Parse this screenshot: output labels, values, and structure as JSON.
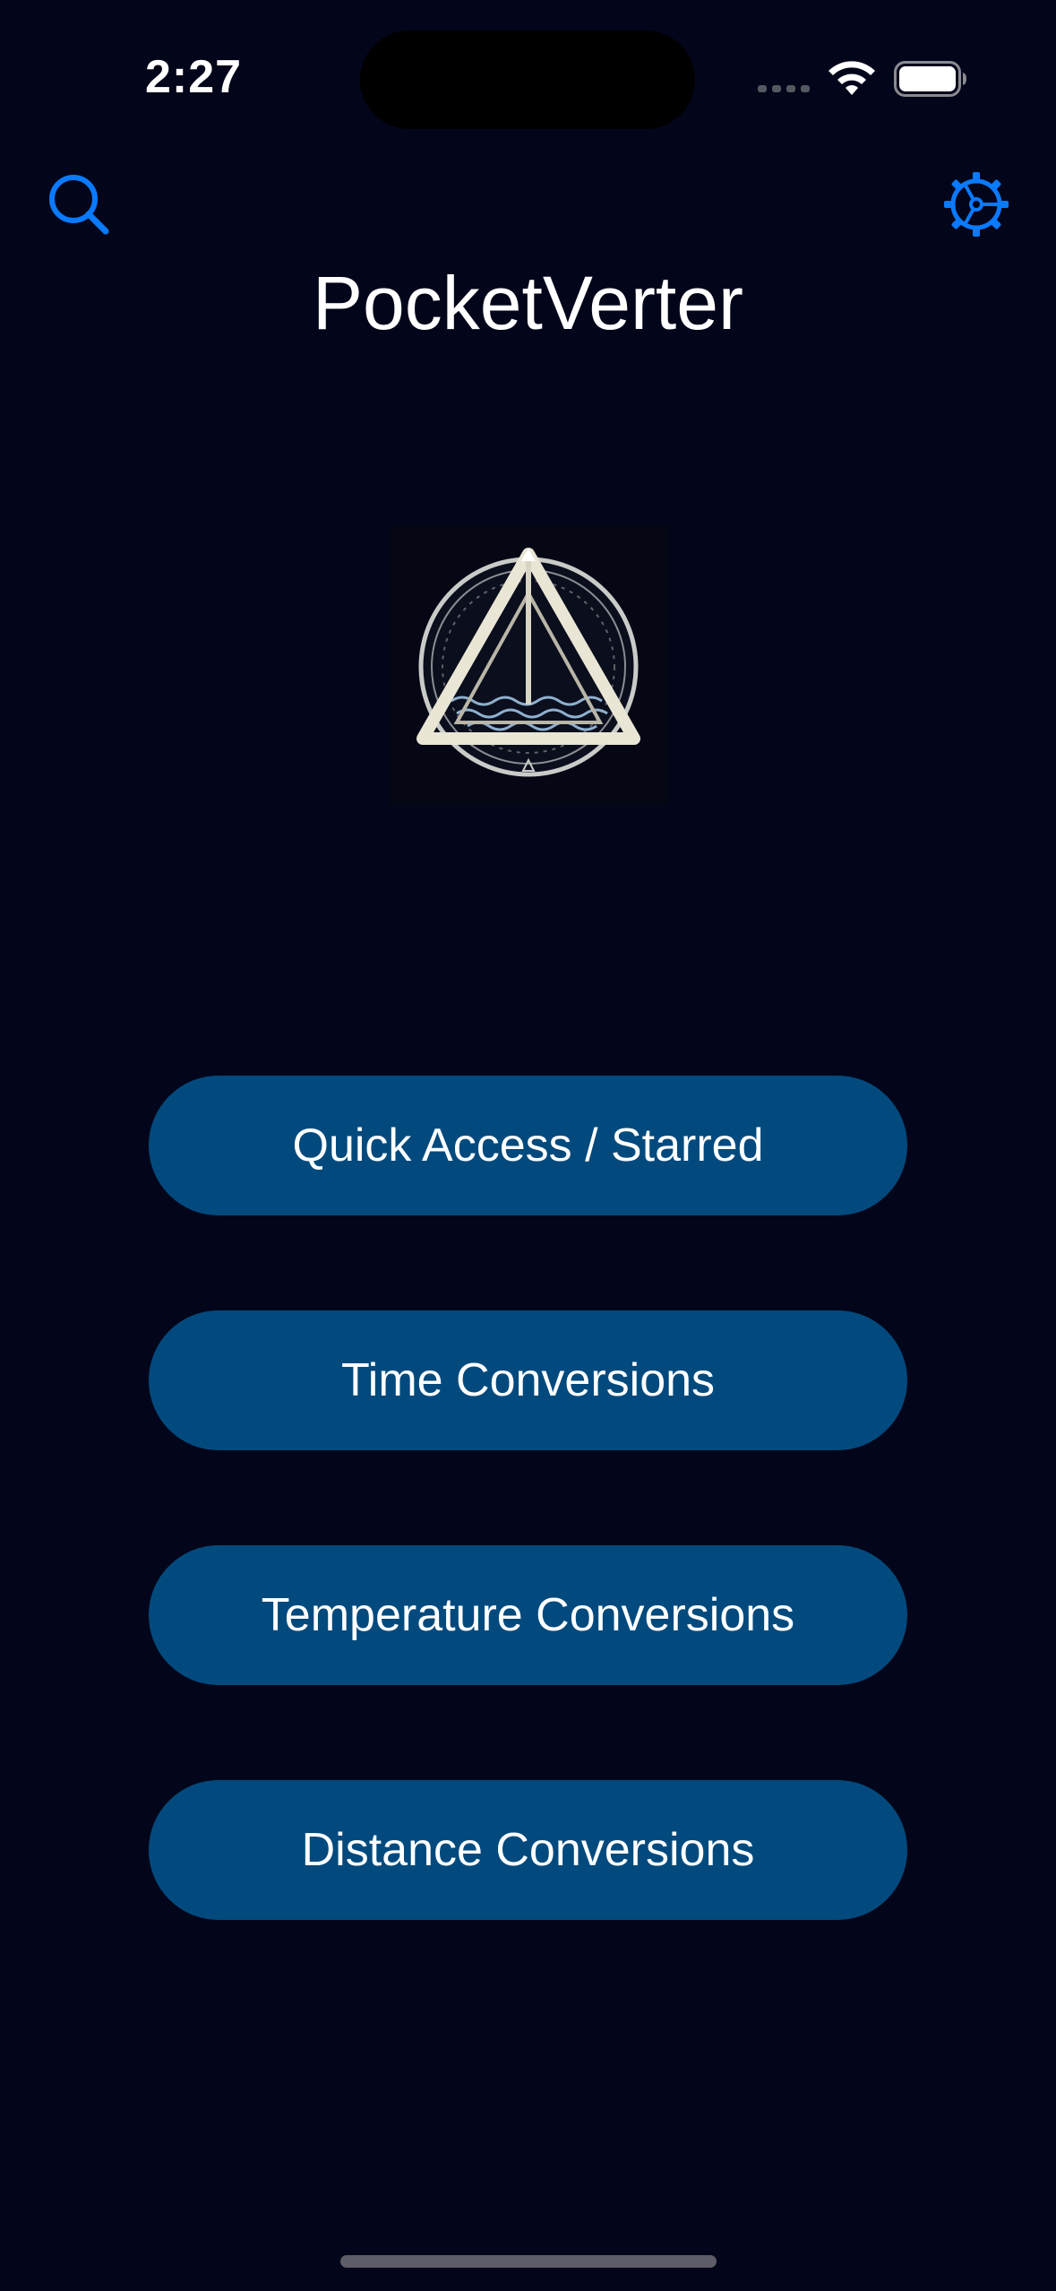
{
  "status_bar": {
    "time": "2:27",
    "signal_icon": "cellular-signal-icon",
    "wifi_icon": "wifi-icon",
    "battery_icon": "battery-icon"
  },
  "header": {
    "search_icon": "search-icon",
    "settings_icon": "gear-icon",
    "title": "PocketVerter",
    "accent_color": "#0a7aff"
  },
  "logo": {
    "icon": "triangle-emblem-logo"
  },
  "menu": {
    "button_color": "#024a7d",
    "items": [
      {
        "label": "Quick Access / Starred"
      },
      {
        "label": "Time Conversions"
      },
      {
        "label": "Temperature Conversions"
      },
      {
        "label": "Distance Conversions"
      }
    ]
  }
}
